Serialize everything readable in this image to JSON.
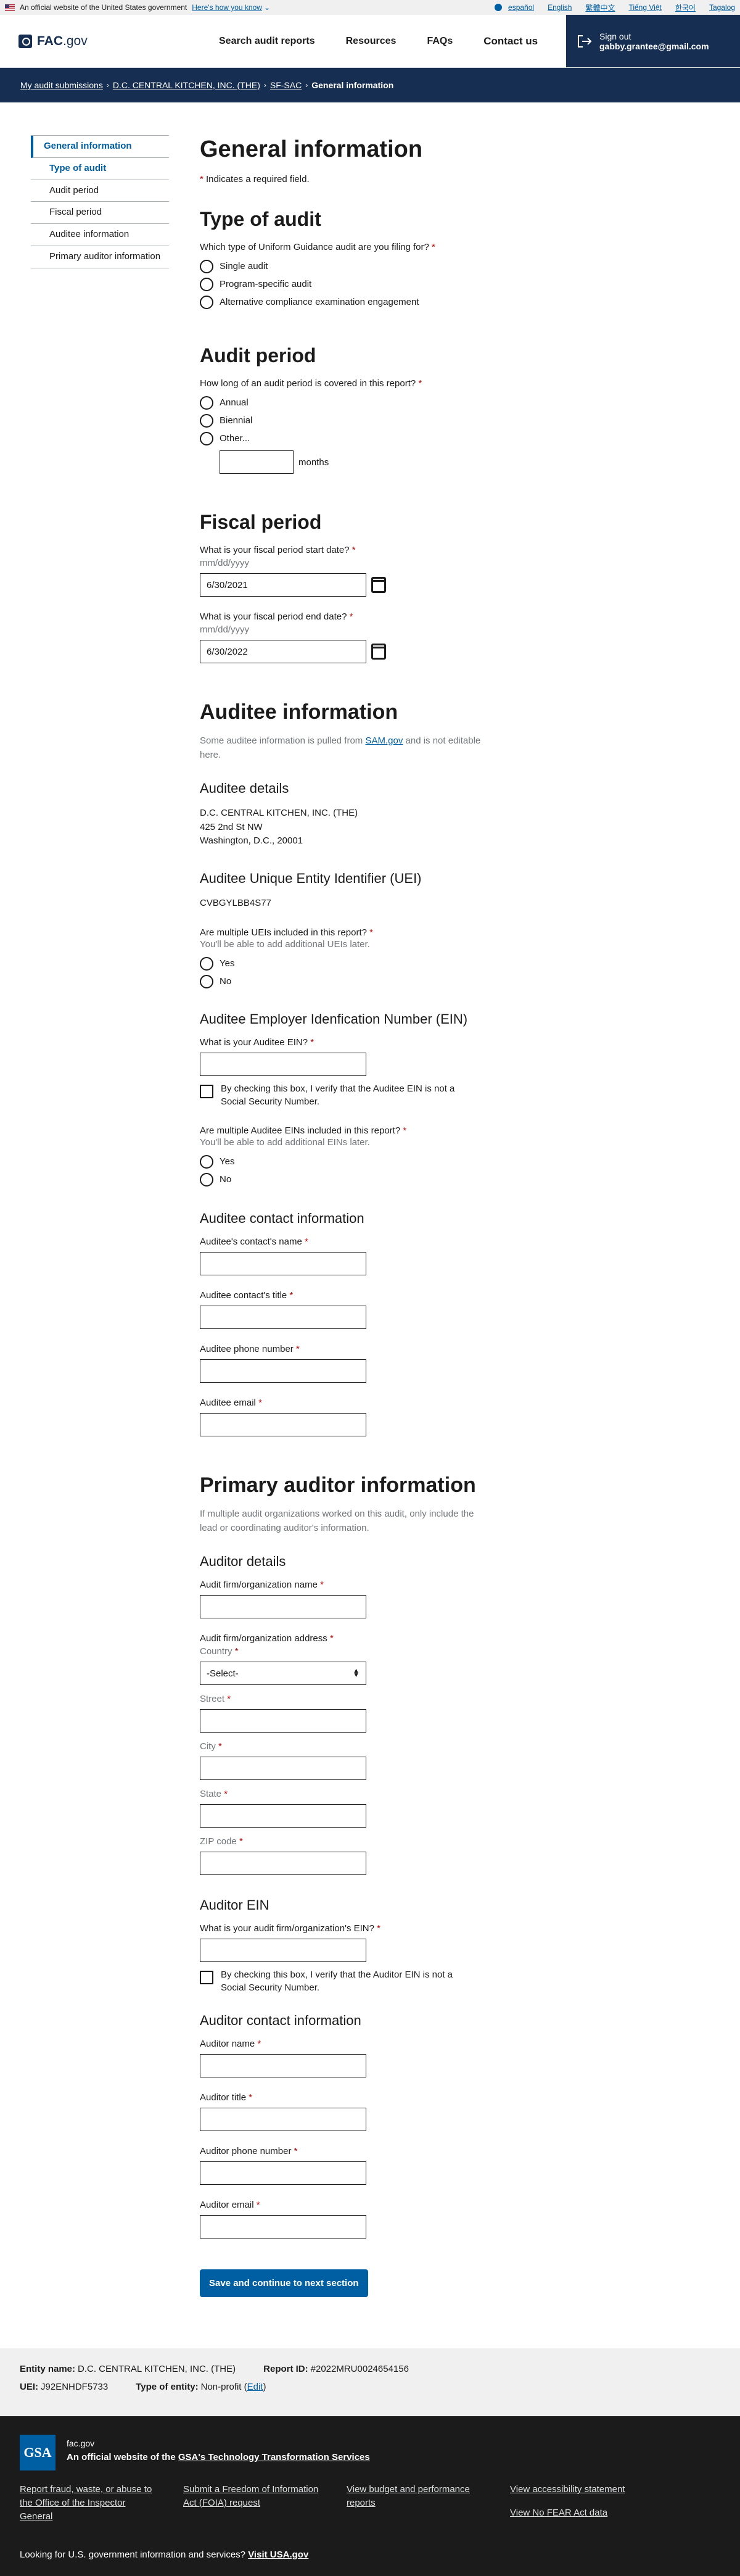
{
  "banner": {
    "text": "An official website of the United States government",
    "know": "Here's how you know",
    "languages": [
      "español",
      "English",
      "繁體中文",
      "Tiếng Việt",
      "한국어",
      "Tagalog"
    ]
  },
  "header": {
    "logo_main": "FAC",
    "logo_tld": ".gov",
    "nav": [
      "Search audit reports",
      "Resources",
      "FAQs",
      "Contact us"
    ],
    "signout_label": "Sign out",
    "signout_email": "gabby.grantee@gmail.com"
  },
  "breadcrumb": {
    "items": [
      "My audit submissions",
      "D.C. CENTRAL KITCHEN, INC. (THE)",
      "SF-SAC",
      "General information"
    ]
  },
  "sidenav": {
    "top": "General information",
    "items": [
      "Type of audit",
      "Audit period",
      "Fiscal period",
      "Auditee information",
      "Primary auditor information"
    ]
  },
  "page": {
    "title": "General information",
    "required_note": "Indicates a required field."
  },
  "type_of_audit": {
    "heading": "Type of audit",
    "question": "Which type of Uniform Guidance audit are you filing for?",
    "options": [
      "Single audit",
      "Program-specific audit",
      "Alternative compliance examination engagement"
    ]
  },
  "audit_period": {
    "heading": "Audit period",
    "question": "How long of an audit period is covered in this report?",
    "options": [
      "Annual",
      "Biennial",
      "Other..."
    ],
    "months_label": "months"
  },
  "fiscal_period": {
    "heading": "Fiscal period",
    "start_label": "What is your fiscal period start date?",
    "start_hint": "mm/dd/yyyy",
    "start_value": "6/30/2021",
    "end_label": "What is your fiscal period end date?",
    "end_hint": "mm/dd/yyyy",
    "end_value": "6/30/2022"
  },
  "auditee": {
    "heading": "Auditee information",
    "intro_pre": "Some auditee information is pulled from ",
    "intro_link": "SAM.gov",
    "intro_post": " and is not editable here.",
    "details_heading": "Auditee details",
    "name": "D.C. CENTRAL KITCHEN, INC. (THE)",
    "street": "425 2nd St NW",
    "city": "Washington, D.C., 20001",
    "uei_heading": "Auditee Unique Entity Identifier (UEI)",
    "uei": "CVBGYLBB4S77",
    "multi_uei_q": "Are multiple UEIs included in this report?",
    "multi_uei_hint": "You'll be able to add additional UEIs later.",
    "yes": "Yes",
    "no": "No",
    "ein_heading": "Auditee Employer Idenfication Number (EIN)",
    "ein_q": "What is your Auditee EIN?",
    "ein_check": "By checking this box, I verify that the Auditee EIN is not a Social Security Number.",
    "multi_ein_q": "Are multiple Auditee EINs included in this report?",
    "multi_ein_hint": "You'll be able to add additional EINs later.",
    "contact_heading": "Auditee contact information",
    "contact_fields": [
      "Auditee's contact's name",
      "Auditee contact's title",
      "Auditee phone number",
      "Auditee email"
    ]
  },
  "auditor": {
    "heading": "Primary auditor information",
    "intro": "If multiple audit organizations worked on this audit, only include the lead or coordinating auditor's information.",
    "details_heading": "Auditor details",
    "firm_name": "Audit firm/organization name",
    "firm_address": "Audit firm/organization address",
    "country": "Country",
    "country_value": "-Select-",
    "address_fields": [
      "Street",
      "City",
      "State",
      "ZIP code"
    ],
    "ein_heading": "Auditor EIN",
    "ein_q": "What is your audit firm/organization's EIN?",
    "ein_check": "By checking this box, I verify that the Auditor EIN is not a Social Security Number.",
    "contact_heading": "Auditor contact information",
    "contact_fields": [
      "Auditor name",
      "Auditor title",
      "Auditor phone number",
      "Auditor email"
    ]
  },
  "submit_label": "Save and continue to next section",
  "summary": {
    "entity_label": "Entity name:",
    "entity_value": "D.C. CENTRAL KITCHEN, INC. (THE)",
    "report_label": "Report ID:",
    "report_value": "#2022MRU0024654156",
    "uei_label": "UEI:",
    "uei_value": "J92ENHDF5733",
    "type_label": "Type of entity:",
    "type_value": "Non-profit",
    "edit": "Edit"
  },
  "footer": {
    "logo": "GSA",
    "domain": "fac.gov",
    "official_pre": "An official website of the ",
    "official_link": "GSA's Technology Transformation Services",
    "links": [
      "Report fraud, waste, or abuse to the Office of the Inspector General",
      "Submit a Freedom of Information Act (FOIA) request",
      "View budget and performance reports",
      "View accessibility statement",
      "View No FEAR Act data"
    ],
    "usa_pre": "Looking for U.S. government information and services? ",
    "usa_link": "Visit USA.gov"
  }
}
